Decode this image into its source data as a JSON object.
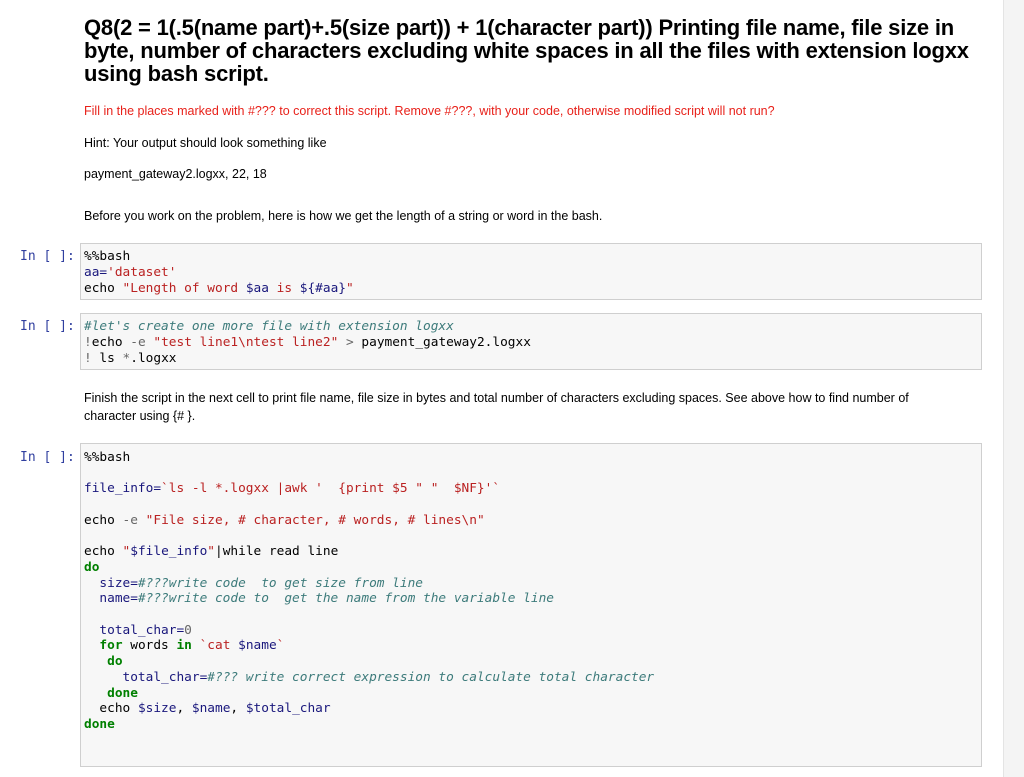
{
  "question": {
    "title": "Q8(2 = 1(.5(name part)+.5(size part)) + 1(character part)) Printing file name, file size in byte, number of characters excluding white spaces in all the files with extension logxx using bash script.",
    "instruction": "Fill in the places marked with #??? to correct this script. Remove #???, with your code, otherwise modified script will not run?",
    "hint": "Hint: Your output should look something like",
    "example_output": "payment_gateway2.logxx, 22, 18",
    "pre_text": "Before you work on the problem, here is how we get the length of a string or word in the bash.",
    "finish_text_line1": "Finish the script in the next cell to print file name, file size in bytes and total number of characters excluding spaces. See above how to find number of",
    "finish_text_line2": "character using {# }."
  },
  "prompts": [
    "In [ ]:",
    "In [ ]:",
    "In [ ]:"
  ],
  "cell1": {
    "magic": "%%bash",
    "l2_var": "aa=",
    "l2_str": "'dataset'",
    "l3_cmd": "echo ",
    "l3_str1": "\"Length of word ",
    "l3_var1": "$aa",
    "l3_str2": " is ",
    "l3_var2": "${#aa}",
    "l3_str3": "\""
  },
  "cell2": {
    "comment": "#let's create one more file with extension logxx",
    "l2_bang": "!",
    "l2_cmd": "echo ",
    "l2_flag": "-e ",
    "l2_str": "\"test line1\\ntest line2\"",
    "l2_op": " > ",
    "l2_rest": "payment_gateway2.logxx",
    "l3_bang": "! ",
    "l3_cmd": "ls ",
    "l3_op": "*",
    "l3_rest": ".logxx"
  },
  "cell3": {
    "magic": "%%bash",
    "fi_var": "file_info=",
    "fi_cmd": "`ls -l *.logxx |awk '  {print $5 \" \"  $NF}'`",
    "echo1_cmd": "echo ",
    "echo1_flag": "-e ",
    "echo1_str": "\"File size, # character, # words, # lines\\n\"",
    "echo2_cmd": "echo ",
    "echo2_str1": "\"",
    "echo2_var": "$file_info",
    "echo2_str2": "\"",
    "echo2_rest": "|while read line",
    "do1": "do",
    "size_var": "  size=",
    "size_com": "#???write code  to get size from line",
    "name_var": "  name=",
    "name_com": "#???write code to  get the name from the variable line",
    "tc_var": "  total_char=",
    "tc_val": "0",
    "for_kw": "  for",
    "for_words": " words ",
    "in_kw": "in",
    "for_rest": " `cat ",
    "for_var": "$name",
    "for_end": "`",
    "do2": "   do",
    "tc2_var": "     total_char=",
    "tc2_com": "#??? write correct expression to calculate total character",
    "done1": "   done",
    "echo3_cmd": "  echo ",
    "echo3_v1": "$size",
    "echo3_c1": ", ",
    "echo3_v2": "$name",
    "echo3_c2": ", ",
    "echo3_v3": "$total_char",
    "done2": "done"
  }
}
